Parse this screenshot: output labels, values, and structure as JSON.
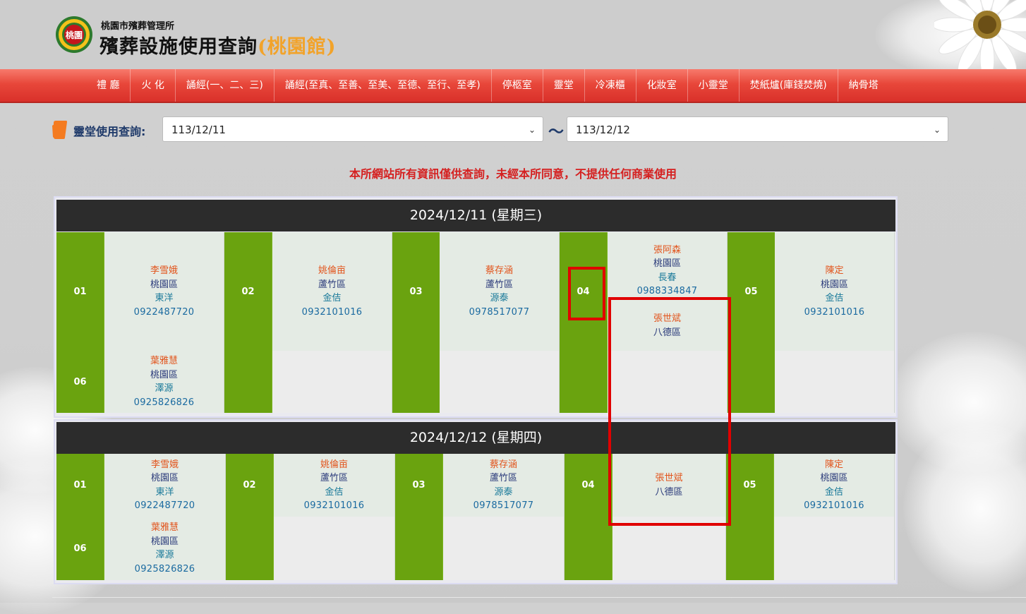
{
  "header": {
    "org": "桃園市殯葬管理所",
    "title": "殯葬設施使用查詢",
    "branch": "(桃園館)",
    "logo_text": "桃園"
  },
  "nav": [
    {
      "label": "禮 廳"
    },
    {
      "label": "火 化"
    },
    {
      "label": "誦經(一、二、三)"
    },
    {
      "label": "誦經(至真、至善、至美、至德、至行、至孝)"
    },
    {
      "label": "停柩室"
    },
    {
      "label": "靈堂"
    },
    {
      "label": "冷凍櫃"
    },
    {
      "label": "化妝室"
    },
    {
      "label": "小靈堂"
    },
    {
      "label": "焚紙爐(庫錢焚燒)"
    },
    {
      "label": "納骨塔"
    }
  ],
  "query": {
    "label": "靈堂使用查詢:",
    "from": "113/12/11",
    "separator": "～",
    "to": "113/12/12"
  },
  "notice": "本所網站所有資訊僅供查詢，未經本所同意，不提供任何商業使用",
  "days": [
    {
      "date": "2024/12/11 (星期三)",
      "row1": [
        {
          "no": "01",
          "lines": [
            [
              "李雪娥",
              "name"
            ],
            [
              "桃園區",
              "dist"
            ],
            [
              "東洋",
              "co"
            ],
            [
              "0922487720",
              "ph"
            ]
          ]
        },
        {
          "no": "02",
          "lines": [
            [
              "姚倫亩",
              "name"
            ],
            [
              "蘆竹區",
              "dist"
            ],
            [
              "金佶",
              "co"
            ],
            [
              "0932101016",
              "ph"
            ]
          ]
        },
        {
          "no": "03",
          "lines": [
            [
              "蔡存涵",
              "name"
            ],
            [
              "蘆竹區",
              "dist"
            ],
            [
              "源泰",
              "co"
            ],
            [
              "0978517077",
              "ph"
            ]
          ]
        },
        {
          "no": "04",
          "lines": [
            [
              "張阿森",
              "name"
            ],
            [
              "桃園區",
              "dist"
            ],
            [
              "長春",
              "co"
            ],
            [
              "0988334847",
              "ph"
            ],
            [
              "",
              ""
            ],
            [
              "張世斌",
              "name"
            ],
            [
              "八德區",
              "dist"
            ]
          ]
        },
        {
          "no": "05",
          "lines": [
            [
              "陳定",
              "name"
            ],
            [
              "桃園區",
              "dist"
            ],
            [
              "金佶",
              "co"
            ],
            [
              "0932101016",
              "ph"
            ]
          ]
        }
      ],
      "row2": [
        {
          "no": "06",
          "lines": [
            [
              "葉雅慧",
              "name"
            ],
            [
              "桃園區",
              "dist"
            ],
            [
              "澤源",
              "co"
            ],
            [
              "0925826826",
              "ph"
            ]
          ]
        },
        {
          "no": "",
          "lines": []
        },
        {
          "no": "",
          "lines": []
        },
        {
          "no": "",
          "lines": []
        },
        {
          "no": "",
          "lines": []
        }
      ]
    },
    {
      "date": "2024/12/12 (星期四)",
      "row1": [
        {
          "no": "01",
          "lines": [
            [
              "李雪娥",
              "name"
            ],
            [
              "桃園區",
              "dist"
            ],
            [
              "東洋",
              "co"
            ],
            [
              "0922487720",
              "ph"
            ]
          ]
        },
        {
          "no": "02",
          "lines": [
            [
              "姚倫亩",
              "name"
            ],
            [
              "蘆竹區",
              "dist"
            ],
            [
              "金佶",
              "co"
            ],
            [
              "0932101016",
              "ph"
            ]
          ]
        },
        {
          "no": "03",
          "lines": [
            [
              "蔡存涵",
              "name"
            ],
            [
              "蘆竹區",
              "dist"
            ],
            [
              "源泰",
              "co"
            ],
            [
              "0978517077",
              "ph"
            ]
          ]
        },
        {
          "no": "04",
          "lines": [
            [
              "張世斌",
              "name"
            ],
            [
              "八德區",
              "dist"
            ]
          ]
        },
        {
          "no": "05",
          "lines": [
            [
              "陳定",
              "name"
            ],
            [
              "桃園區",
              "dist"
            ],
            [
              "金佶",
              "co"
            ],
            [
              "0932101016",
              "ph"
            ]
          ]
        }
      ],
      "row2": [
        {
          "no": "06",
          "lines": [
            [
              "葉雅慧",
              "name"
            ],
            [
              "桃園區",
              "dist"
            ],
            [
              "澤源",
              "co"
            ],
            [
              "0925826826",
              "ph"
            ]
          ]
        },
        {
          "no": "",
          "lines": []
        },
        {
          "no": "",
          "lines": []
        },
        {
          "no": "",
          "lines": []
        },
        {
          "no": "",
          "lines": []
        }
      ]
    }
  ],
  "colors": {
    "nav_red": "#e8473a",
    "slot_green": "#6aa30f",
    "header_dark": "#2c2c2c",
    "notice_red": "#d52020",
    "highlight_red": "#e00000"
  }
}
